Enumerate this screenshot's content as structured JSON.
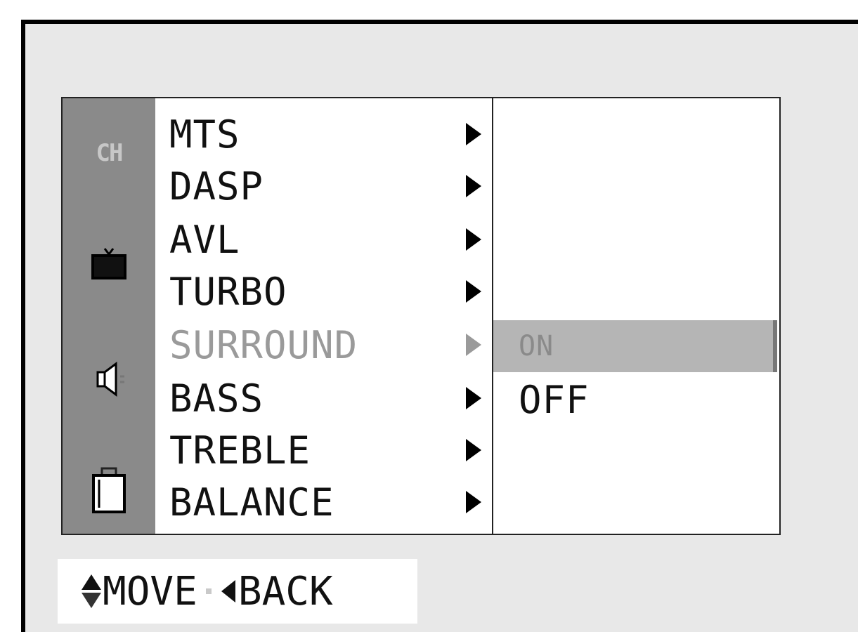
{
  "rail_icons": [
    {
      "name": "channel-icon",
      "label": "CH"
    },
    {
      "name": "picture-icon"
    },
    {
      "name": "audio-icon"
    },
    {
      "name": "lock-icon"
    }
  ],
  "menu": {
    "items": [
      {
        "label": "MTS",
        "state": "normal"
      },
      {
        "label": "DASP",
        "state": "normal"
      },
      {
        "label": "AVL",
        "state": "normal"
      },
      {
        "label": "TURBO",
        "state": "normal"
      },
      {
        "label": "SURROUND",
        "state": "active"
      },
      {
        "label": "BASS",
        "state": "normal"
      },
      {
        "label": "TREBLE",
        "state": "normal"
      },
      {
        "label": "BALANCE",
        "state": "normal"
      }
    ]
  },
  "submenu": {
    "options": [
      {
        "label": "ON",
        "selected": true
      },
      {
        "label": "OFF",
        "selected": false
      }
    ]
  },
  "hints": {
    "move_label": "MOVE",
    "back_label": "BACK"
  },
  "colors": {
    "rail_background": "#8a8a8a",
    "selected_background": "#b5b5b5",
    "dim_text": "#9a9a9a"
  }
}
